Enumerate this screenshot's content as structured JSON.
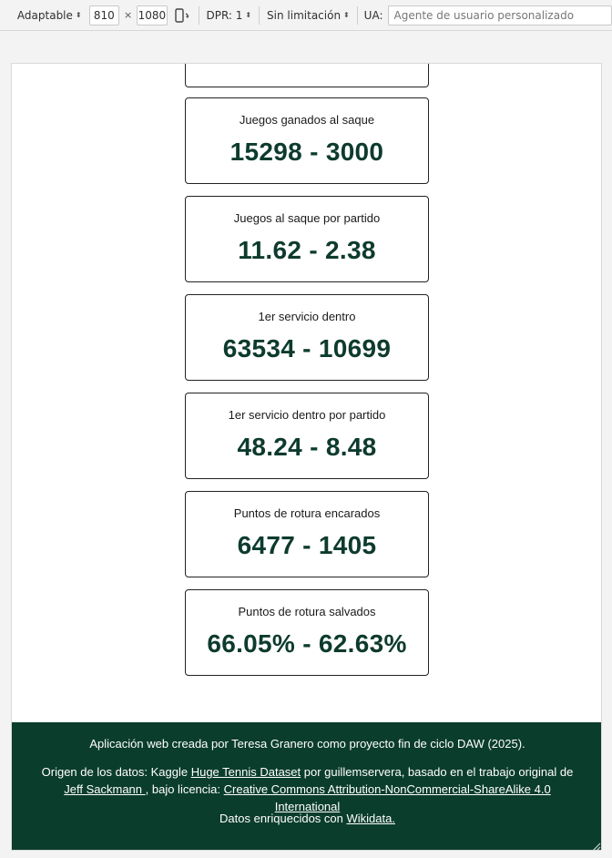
{
  "toolbar": {
    "device_mode": "Adaptable",
    "width": "810",
    "times": "×",
    "height": "1080",
    "dpr": "DPR: 1",
    "throttling": "Sin limitación",
    "ua_label": "UA:",
    "ua_placeholder": "Agente de usuario personalizado"
  },
  "stats": [
    {
      "label": "",
      "value": ""
    },
    {
      "label": "Juegos ganados al saque",
      "value": "15298 - 3000"
    },
    {
      "label": "Juegos al saque por partido",
      "value": "11.62 - 2.38"
    },
    {
      "label": "1er servicio dentro",
      "value": "63534 - 10699"
    },
    {
      "label": "1er servicio dentro por partido",
      "value": "48.24 - 8.48"
    },
    {
      "label": "Puntos de rotura encarados",
      "value": "6477 - 1405"
    },
    {
      "label": "Puntos de rotura salvados",
      "value": "66.05% - 62.63%"
    }
  ],
  "footer": {
    "credit": "Aplicación web creada por Teresa Granero como proyecto fin de ciclo DAW (2025).",
    "source_prefix": "Origen de los datos: Kaggle ",
    "dataset_link": "Huge Tennis Dataset",
    "source_middle": " por guillemservera, basado en el trabajo original de ",
    "author_link": "Jeff Sackmann ",
    "license_prefix": ", bajo licencia: ",
    "license_link": "Creative Commons Attribution-NonCommercial-ShareAlike 4.0 International",
    "enriched_prefix": "Datos enriquecidos con ",
    "wikidata_link": "Wikidata."
  },
  "colors": {
    "footer_bg": "#0b3d2c",
    "stat_value": "#0d3b2e"
  }
}
